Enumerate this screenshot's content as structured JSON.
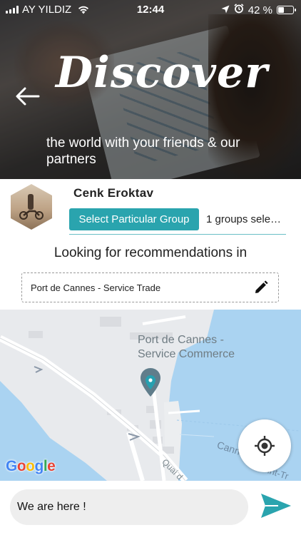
{
  "status_bar": {
    "carrier": "AY YILDIZ",
    "time": "12:44",
    "battery_percent": "42 %",
    "battery_level": 0.42,
    "icons": [
      "signal-icon",
      "wifi-icon",
      "location-arrow-icon",
      "alarm-icon",
      "battery-icon"
    ]
  },
  "hero": {
    "title": "Discover",
    "subtitle": "the world with your friends & our partners",
    "back_icon": "back-arrow-icon"
  },
  "profile": {
    "name": "Cenk Eroktav",
    "group_button_label": "Select Particular Group",
    "groups_selected": "1 groups sele…"
  },
  "recommendations": {
    "heading": "Looking for recommendations in",
    "location": "Port de Cannes - Service Trade",
    "edit_icon": "edit-pencil-icon"
  },
  "map": {
    "place_label": "Port de Cannes - Service Commerce",
    "road_label_1": "Quai d",
    "road_label_2": "Cann",
    "road_label_3": "int-Tr",
    "provider": "Google",
    "locate_icon": "my-location-icon"
  },
  "composer": {
    "message_value": "We are here !",
    "send_icon": "send-icon"
  },
  "colors": {
    "accent": "#2aa4ae",
    "water": "#aad3f1",
    "land": "#e8eaed"
  }
}
